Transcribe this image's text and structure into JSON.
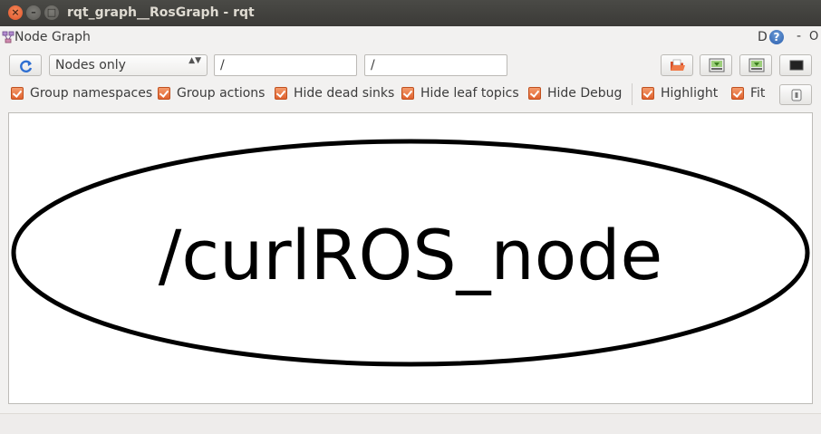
{
  "window": {
    "title": "rqt_graph__RosGraph - rqt",
    "close_glyph": "×",
    "minimize_glyph": "–",
    "maximize_glyph": "□"
  },
  "plugin": {
    "title": "Node Graph",
    "dock_label": "D",
    "help_glyph": "?",
    "minimize_glyph": "-",
    "close_glyph": "O"
  },
  "toolbar": {
    "graph_type": "Nodes only",
    "combo_arrows": "▲▼",
    "namespace_filter": "/",
    "topic_filter": "/"
  },
  "options": [
    {
      "label": "Group namespaces",
      "checked": true
    },
    {
      "label": "Group actions",
      "checked": true
    },
    {
      "label": "Hide dead sinks",
      "checked": true
    },
    {
      "label": "Hide leaf topics",
      "checked": true
    },
    {
      "label": "Hide Debug",
      "checked": true
    },
    {
      "label": "Highlight",
      "checked": true
    },
    {
      "label": "Fit",
      "checked": true
    }
  ],
  "graph": {
    "nodes": [
      {
        "label": "/curlROS_node",
        "shape": "ellipse"
      }
    ]
  },
  "colors": {
    "checkbox": "#e0622e",
    "titlebar": "#3b3a37",
    "help_icon": "#2b5fae"
  }
}
